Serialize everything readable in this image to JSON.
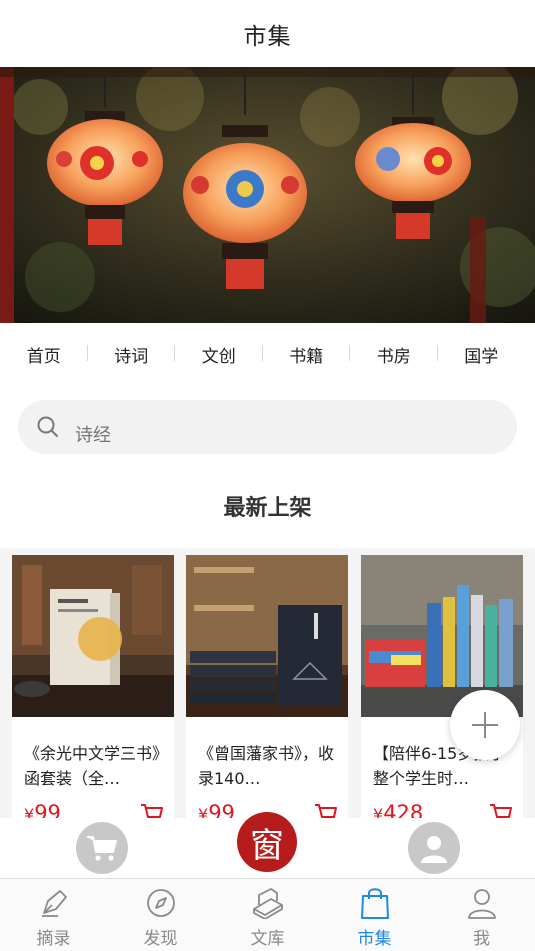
{
  "header": {
    "title": "市集"
  },
  "nav": {
    "items": [
      {
        "label": "首页"
      },
      {
        "label": "诗词"
      },
      {
        "label": "文创"
      },
      {
        "label": "书籍"
      },
      {
        "label": "书房"
      },
      {
        "label": "国学"
      }
    ]
  },
  "search": {
    "placeholder": "诗经"
  },
  "section": {
    "title": "最新上架"
  },
  "products": [
    {
      "name": "《余光中文学三书》函套装（全…",
      "currency": "¥",
      "price": "99"
    },
    {
      "name": "《曾国藩家书》，收录140…",
      "currency": "¥",
      "price": "99"
    },
    {
      "name": "【陪伴6-15岁孩子整个学生时…",
      "currency": "¥",
      "price": "428"
    }
  ],
  "action_bar": {
    "center_label": "窗"
  },
  "tabs": [
    {
      "label": "摘录",
      "icon": "pen-icon",
      "active": false
    },
    {
      "label": "发现",
      "icon": "compass-icon",
      "active": false
    },
    {
      "label": "文库",
      "icon": "books-icon",
      "active": false
    },
    {
      "label": "市集",
      "icon": "shopping-bag-icon",
      "active": true
    },
    {
      "label": "我",
      "icon": "person-icon",
      "active": false
    }
  ],
  "colors": {
    "accent": "#1e88e5",
    "price": "#e0161e",
    "brand_red": "#b71c1c"
  }
}
